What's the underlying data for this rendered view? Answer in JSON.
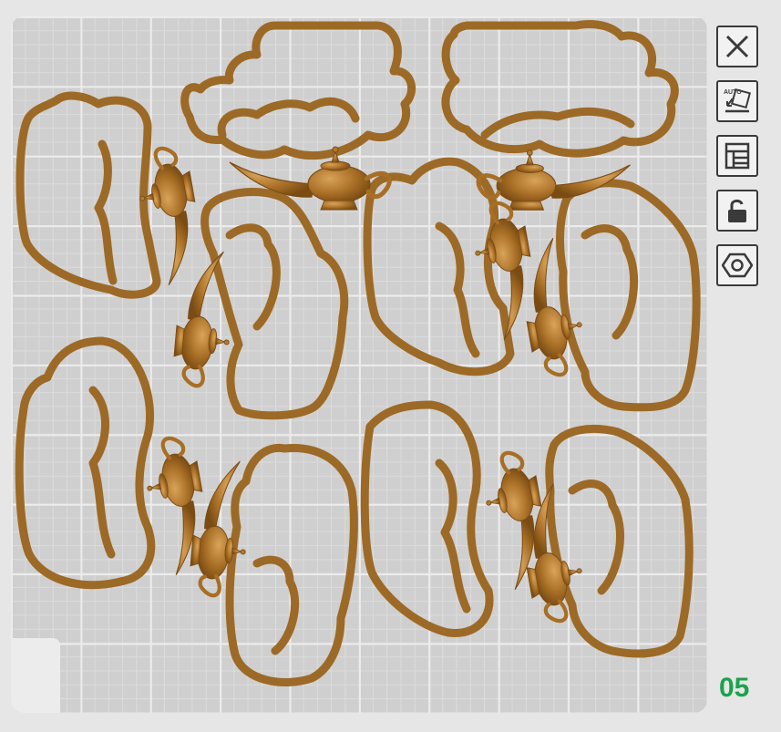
{
  "plate": {
    "number": "05",
    "bed_color": "#cfcfcf",
    "grid_color": "#ececec",
    "model_color": "#b07a30",
    "model_count": 8
  },
  "toolbar": {
    "buttons": [
      {
        "name": "close",
        "icon": "close-icon"
      },
      {
        "name": "auto-arrange",
        "icon": "auto-arrange-icon",
        "label": "AUTO"
      },
      {
        "name": "arrange-layout",
        "icon": "layout-icon"
      },
      {
        "name": "lock",
        "icon": "lock-icon"
      },
      {
        "name": "settings",
        "icon": "hex-nut-icon"
      }
    ]
  },
  "colors": {
    "number_accent": "#1aa34a",
    "button_border": "#3a3a3a"
  }
}
